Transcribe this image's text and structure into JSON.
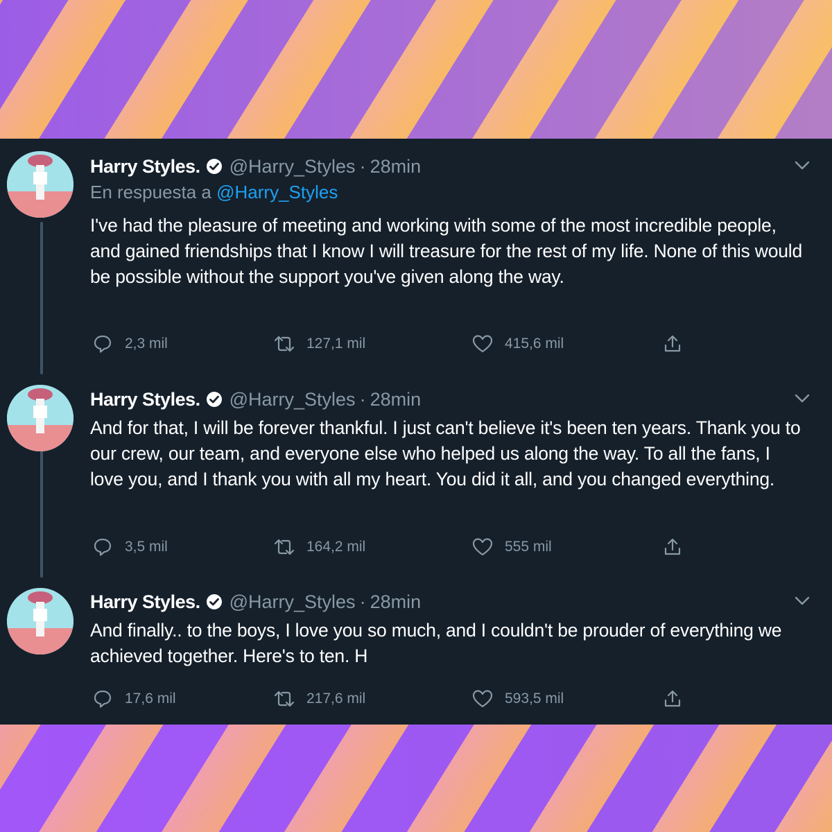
{
  "colors": {
    "panel_bg": "#15202b",
    "text_primary": "#ffffff",
    "text_secondary": "#8899a6",
    "link": "#1da1f2",
    "stripe_orange": "#f6b06c",
    "stripe_purple": "#8b4cff"
  },
  "tweets": [
    {
      "name": "Harry Styles.",
      "handle": "@Harry_Styles",
      "separator": "·",
      "time": "28min",
      "reply_prefix": "En respuesta a",
      "reply_handle": "@Harry_Styles",
      "text": "I've had the pleasure of meeting and working with some of the most incredible people, and gained friendships that I know I will treasure for the rest of my life. None of this would be possible without the support you've given along the way.",
      "replies": "2,3 mil",
      "retweets": "127,1 mil",
      "likes": "415,6 mil"
    },
    {
      "name": "Harry Styles.",
      "handle": "@Harry_Styles",
      "separator": "·",
      "time": "28min",
      "text": "And for that, I will be forever thankful. I just can't believe it's been ten years. Thank you to our crew, our team, and everyone else who helped us along the way. To all the fans, I love you, and I thank you with all my heart. You did it all, and you changed everything.",
      "replies": "3,5 mil",
      "retweets": "164,2 mil",
      "likes": "555 mil"
    },
    {
      "name": "Harry Styles.",
      "handle": "@Harry_Styles",
      "separator": "·",
      "time": "28min",
      "text": "And finally.. to the boys, I love you so much, and I couldn't be prouder of everything we achieved together. Here's to ten. H",
      "replies": "17,6 mil",
      "retweets": "217,6 mil",
      "likes": "593,5 mil"
    }
  ],
  "icons": {
    "verified": "verified-badge-icon",
    "chevron": "chevron-down-icon",
    "reply": "reply-icon",
    "retweet": "retweet-icon",
    "like": "heart-icon",
    "share": "share-icon"
  }
}
